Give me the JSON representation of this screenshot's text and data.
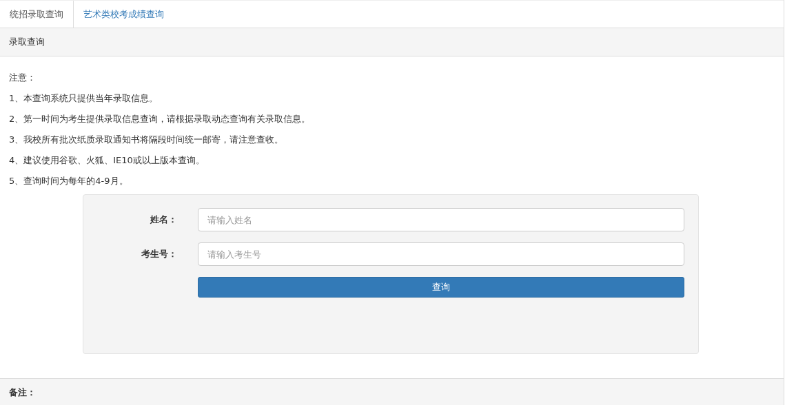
{
  "tabs": [
    {
      "label": "统招录取查询",
      "selected": true
    },
    {
      "label": "艺术类校考成绩查询",
      "selected": false
    }
  ],
  "panel": {
    "title": "录取查询",
    "notice_title": "注意：",
    "notices": [
      "1、本查询系统只提供当年录取信息。",
      "2、第一时间为考生提供录取信息查询，请根据录取动态查询有关录取信息。",
      "3、我校所有批次纸质录取通知书将隔段时间统一邮寄，请注意查收。",
      "4、建议使用谷歌、火狐、IE10或以上版本查询。",
      "5、查询时间为每年的4-9月。"
    ],
    "form": {
      "fields": [
        {
          "label": "姓名：",
          "placeholder": "请输入姓名"
        },
        {
          "label": "考生号：",
          "placeholder": "请输入考生号"
        }
      ],
      "submit": "查询"
    }
  },
  "footer": {
    "title": "备注："
  }
}
